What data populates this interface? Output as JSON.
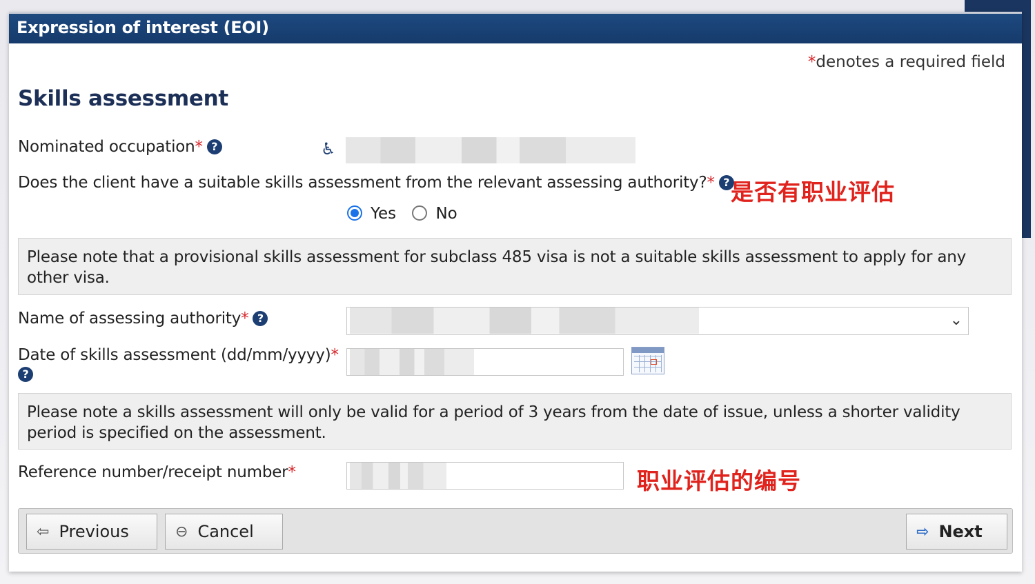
{
  "header": {
    "title": "Expression of interest (EOI)"
  },
  "required_note": {
    "star": "*",
    "text": "denotes a required field"
  },
  "section": {
    "title": "Skills assessment"
  },
  "fields": {
    "nominated_occupation": {
      "label": "Nominated occupation",
      "star": "*",
      "help": "?"
    },
    "suitable_assessment": {
      "label": "Does the client have a suitable skills assessment from the relevant assessing authority?",
      "star": "*",
      "help": "?",
      "options": [
        "Yes",
        "No"
      ],
      "selected": "Yes"
    },
    "assessing_authority": {
      "label": "Name of assessing authority",
      "star": "*",
      "help": "?",
      "chevron": "⌄"
    },
    "assessment_date": {
      "label": "Date of skills assessment (dd/mm/yyyy)",
      "star": "*",
      "help": "?"
    },
    "reference_number": {
      "label": "Reference number/receipt number",
      "star": "*"
    }
  },
  "notes": {
    "provisional": "Please note that a provisional skills assessment for subclass 485 visa is not a suitable skills assessment to apply for any other visa.",
    "validity": "Please note a skills assessment will only be valid for a period of 3 years from the date of issue, unless a shorter validity period is specified on the assessment."
  },
  "annotations": {
    "has_assessment": "是否有职业评估",
    "reference_number": "职业评估的编号"
  },
  "buttons": {
    "previous": {
      "label": "Previous",
      "icon": "⇦"
    },
    "cancel": {
      "label": "Cancel",
      "icon": "⊖"
    },
    "next": {
      "label": "Next",
      "icon": "⇨"
    }
  },
  "icons": {
    "accessibility": "♿"
  },
  "colors": {
    "header": "#163a6b",
    "title": "#1c2f57",
    "required": "#d7262b",
    "annotation": "#e0231c",
    "radio_selected": "#1a73e8"
  }
}
